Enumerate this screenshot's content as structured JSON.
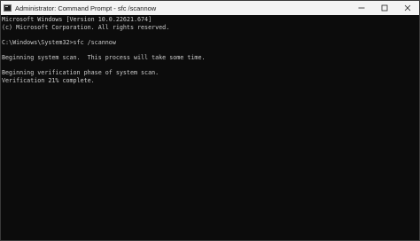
{
  "window": {
    "title": "Administrator: Command Prompt - sfc  /scannow",
    "icon": "terminal-icon",
    "controls": {
      "minimize_icon": "minimize-icon",
      "maximize_icon": "maximize-icon",
      "close_icon": "close-icon"
    }
  },
  "console": {
    "lines": [
      "Microsoft Windows [Version 10.0.22621.674]",
      "(c) Microsoft Corporation. All rights reserved.",
      "",
      "C:\\Windows\\System32>sfc /scannow",
      "",
      "Beginning system scan.  This process will take some time.",
      "",
      "Beginning verification phase of system scan.",
      "Verification 21% complete."
    ]
  },
  "colors": {
    "console_background": "#0c0c0c",
    "console_text": "#cccccc",
    "titlebar_background": "#f3f3f3"
  }
}
